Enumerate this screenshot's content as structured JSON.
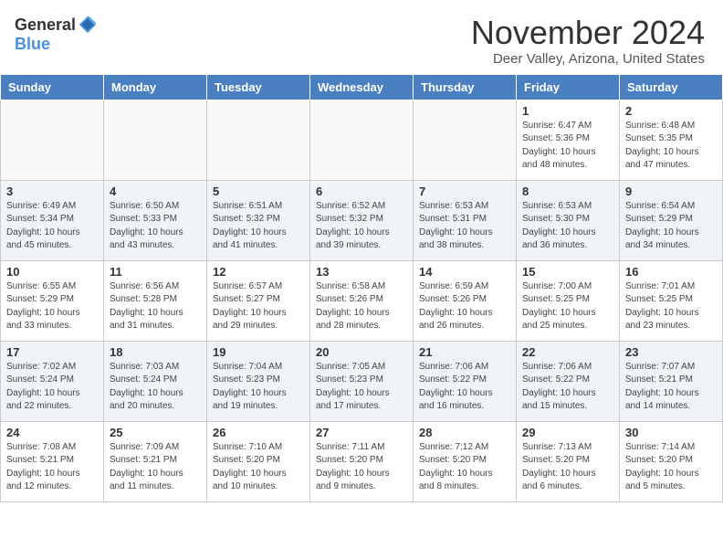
{
  "header": {
    "logo_general": "General",
    "logo_blue": "Blue",
    "month_title": "November 2024",
    "location": "Deer Valley, Arizona, United States"
  },
  "calendar": {
    "days_of_week": [
      "Sunday",
      "Monday",
      "Tuesday",
      "Wednesday",
      "Thursday",
      "Friday",
      "Saturday"
    ],
    "weeks": [
      [
        {
          "day": "",
          "info": ""
        },
        {
          "day": "",
          "info": ""
        },
        {
          "day": "",
          "info": ""
        },
        {
          "day": "",
          "info": ""
        },
        {
          "day": "",
          "info": ""
        },
        {
          "day": "1",
          "info": "Sunrise: 6:47 AM\nSunset: 5:36 PM\nDaylight: 10 hours\nand 48 minutes."
        },
        {
          "day": "2",
          "info": "Sunrise: 6:48 AM\nSunset: 5:35 PM\nDaylight: 10 hours\nand 47 minutes."
        }
      ],
      [
        {
          "day": "3",
          "info": "Sunrise: 6:49 AM\nSunset: 5:34 PM\nDaylight: 10 hours\nand 45 minutes."
        },
        {
          "day": "4",
          "info": "Sunrise: 6:50 AM\nSunset: 5:33 PM\nDaylight: 10 hours\nand 43 minutes."
        },
        {
          "day": "5",
          "info": "Sunrise: 6:51 AM\nSunset: 5:32 PM\nDaylight: 10 hours\nand 41 minutes."
        },
        {
          "day": "6",
          "info": "Sunrise: 6:52 AM\nSunset: 5:32 PM\nDaylight: 10 hours\nand 39 minutes."
        },
        {
          "day": "7",
          "info": "Sunrise: 6:53 AM\nSunset: 5:31 PM\nDaylight: 10 hours\nand 38 minutes."
        },
        {
          "day": "8",
          "info": "Sunrise: 6:53 AM\nSunset: 5:30 PM\nDaylight: 10 hours\nand 36 minutes."
        },
        {
          "day": "9",
          "info": "Sunrise: 6:54 AM\nSunset: 5:29 PM\nDaylight: 10 hours\nand 34 minutes."
        }
      ],
      [
        {
          "day": "10",
          "info": "Sunrise: 6:55 AM\nSunset: 5:29 PM\nDaylight: 10 hours\nand 33 minutes."
        },
        {
          "day": "11",
          "info": "Sunrise: 6:56 AM\nSunset: 5:28 PM\nDaylight: 10 hours\nand 31 minutes."
        },
        {
          "day": "12",
          "info": "Sunrise: 6:57 AM\nSunset: 5:27 PM\nDaylight: 10 hours\nand 29 minutes."
        },
        {
          "day": "13",
          "info": "Sunrise: 6:58 AM\nSunset: 5:26 PM\nDaylight: 10 hours\nand 28 minutes."
        },
        {
          "day": "14",
          "info": "Sunrise: 6:59 AM\nSunset: 5:26 PM\nDaylight: 10 hours\nand 26 minutes."
        },
        {
          "day": "15",
          "info": "Sunrise: 7:00 AM\nSunset: 5:25 PM\nDaylight: 10 hours\nand 25 minutes."
        },
        {
          "day": "16",
          "info": "Sunrise: 7:01 AM\nSunset: 5:25 PM\nDaylight: 10 hours\nand 23 minutes."
        }
      ],
      [
        {
          "day": "17",
          "info": "Sunrise: 7:02 AM\nSunset: 5:24 PM\nDaylight: 10 hours\nand 22 minutes."
        },
        {
          "day": "18",
          "info": "Sunrise: 7:03 AM\nSunset: 5:24 PM\nDaylight: 10 hours\nand 20 minutes."
        },
        {
          "day": "19",
          "info": "Sunrise: 7:04 AM\nSunset: 5:23 PM\nDaylight: 10 hours\nand 19 minutes."
        },
        {
          "day": "20",
          "info": "Sunrise: 7:05 AM\nSunset: 5:23 PM\nDaylight: 10 hours\nand 17 minutes."
        },
        {
          "day": "21",
          "info": "Sunrise: 7:06 AM\nSunset: 5:22 PM\nDaylight: 10 hours\nand 16 minutes."
        },
        {
          "day": "22",
          "info": "Sunrise: 7:06 AM\nSunset: 5:22 PM\nDaylight: 10 hours\nand 15 minutes."
        },
        {
          "day": "23",
          "info": "Sunrise: 7:07 AM\nSunset: 5:21 PM\nDaylight: 10 hours\nand 14 minutes."
        }
      ],
      [
        {
          "day": "24",
          "info": "Sunrise: 7:08 AM\nSunset: 5:21 PM\nDaylight: 10 hours\nand 12 minutes."
        },
        {
          "day": "25",
          "info": "Sunrise: 7:09 AM\nSunset: 5:21 PM\nDaylight: 10 hours\nand 11 minutes."
        },
        {
          "day": "26",
          "info": "Sunrise: 7:10 AM\nSunset: 5:20 PM\nDaylight: 10 hours\nand 10 minutes."
        },
        {
          "day": "27",
          "info": "Sunrise: 7:11 AM\nSunset: 5:20 PM\nDaylight: 10 hours\nand 9 minutes."
        },
        {
          "day": "28",
          "info": "Sunrise: 7:12 AM\nSunset: 5:20 PM\nDaylight: 10 hours\nand 8 minutes."
        },
        {
          "day": "29",
          "info": "Sunrise: 7:13 AM\nSunset: 5:20 PM\nDaylight: 10 hours\nand 6 minutes."
        },
        {
          "day": "30",
          "info": "Sunrise: 7:14 AM\nSunset: 5:20 PM\nDaylight: 10 hours\nand 5 minutes."
        }
      ]
    ]
  }
}
